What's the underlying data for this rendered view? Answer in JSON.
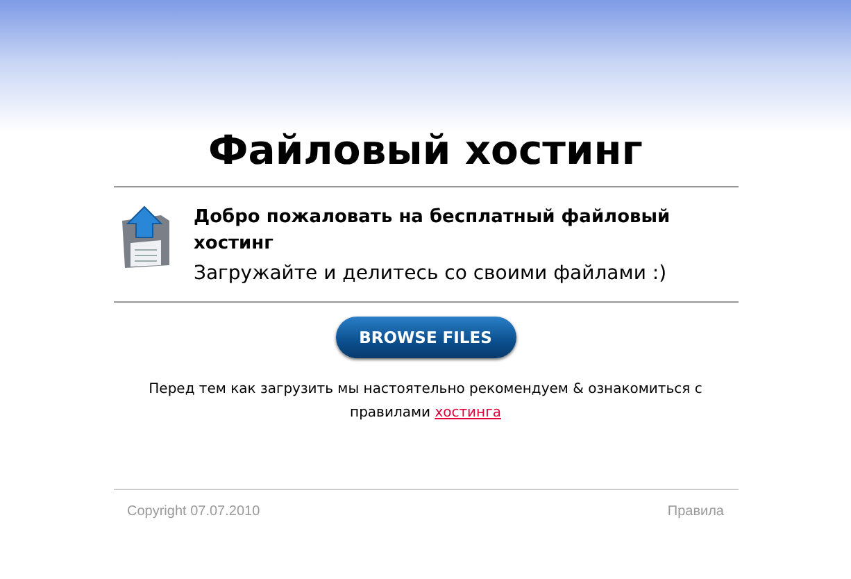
{
  "title": "Файловый хостинг",
  "welcome": {
    "heading": "Добро пожаловать на бесплатный файловый хостинг",
    "subtitle": "Загружайте и делитесь со своими файлами :)"
  },
  "browse_button": "BROWSE FILES",
  "notice": {
    "text": "Перед тем как загрузить мы настоятельно рекомендуем & ознакомиться с правилами",
    "link": "хостинга"
  },
  "footer": {
    "copyright": "Copyright 07.07.2010",
    "link": "Правила"
  }
}
